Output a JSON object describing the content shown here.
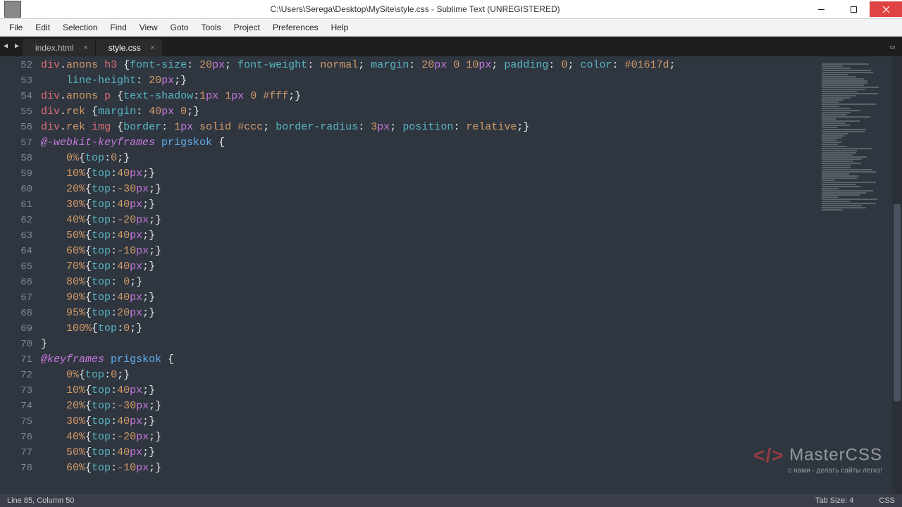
{
  "window": {
    "title": "C:\\Users\\Serega\\Desktop\\MySite\\style.css - Sublime Text (UNREGISTERED)"
  },
  "menu": {
    "items": [
      "File",
      "Edit",
      "Selection",
      "Find",
      "View",
      "Goto",
      "Tools",
      "Project",
      "Preferences",
      "Help"
    ]
  },
  "tabs": {
    "items": [
      {
        "label": "index.html",
        "active": false
      },
      {
        "label": "style.css",
        "active": true
      }
    ],
    "panes_icon": "▭"
  },
  "code": {
    "first_line_number": 52,
    "lines": [
      {
        "n": 52,
        "tokens": [
          [
            "sel",
            "div"
          ],
          [
            "punc",
            "."
          ],
          [
            "cls",
            "anons"
          ],
          [
            "punc",
            " "
          ],
          [
            "sel",
            "h3"
          ],
          [
            "punc",
            " {"
          ],
          [
            "prop",
            "font-size"
          ],
          [
            "punc",
            ": "
          ],
          [
            "num",
            "20"
          ],
          [
            "unit",
            "px"
          ],
          [
            "punc",
            "; "
          ],
          [
            "prop",
            "font-weight"
          ],
          [
            "punc",
            ": "
          ],
          [
            "val",
            "normal"
          ],
          [
            "punc",
            "; "
          ],
          [
            "prop",
            "margin"
          ],
          [
            "punc",
            ": "
          ],
          [
            "num",
            "20"
          ],
          [
            "unit",
            "px"
          ],
          [
            "punc",
            " "
          ],
          [
            "num",
            "0"
          ],
          [
            "punc",
            " "
          ],
          [
            "num",
            "10"
          ],
          [
            "unit",
            "px"
          ],
          [
            "punc",
            "; "
          ],
          [
            "prop",
            "padding"
          ],
          [
            "punc",
            ": "
          ],
          [
            "num",
            "0"
          ],
          [
            "punc",
            "; "
          ],
          [
            "prop",
            "color"
          ],
          [
            "punc",
            ": "
          ],
          [
            "hex",
            "#01617d"
          ],
          [
            "punc",
            ";"
          ]
        ]
      },
      {
        "n": 53,
        "indent": 4,
        "tokens": [
          [
            "prop",
            "line-height"
          ],
          [
            "punc",
            ": "
          ],
          [
            "num",
            "20"
          ],
          [
            "unit",
            "px"
          ],
          [
            "punc",
            ";}"
          ]
        ]
      },
      {
        "n": 54,
        "tokens": [
          [
            "sel",
            "div"
          ],
          [
            "punc",
            "."
          ],
          [
            "cls",
            "anons"
          ],
          [
            "punc",
            " "
          ],
          [
            "sel",
            "p"
          ],
          [
            "punc",
            " {"
          ],
          [
            "prop",
            "text-shadow"
          ],
          [
            "punc",
            ":"
          ],
          [
            "num",
            "1"
          ],
          [
            "unit",
            "px"
          ],
          [
            "punc",
            " "
          ],
          [
            "num",
            "1"
          ],
          [
            "unit",
            "px"
          ],
          [
            "punc",
            " "
          ],
          [
            "num",
            "0"
          ],
          [
            "punc",
            " "
          ],
          [
            "hex",
            "#fff"
          ],
          [
            "punc",
            ";}"
          ]
        ]
      },
      {
        "n": 55,
        "tokens": [
          [
            "sel",
            "div"
          ],
          [
            "punc",
            "."
          ],
          [
            "cls",
            "rek"
          ],
          [
            "punc",
            " {"
          ],
          [
            "prop",
            "margin"
          ],
          [
            "punc",
            ": "
          ],
          [
            "num",
            "40"
          ],
          [
            "unit",
            "px"
          ],
          [
            "punc",
            " "
          ],
          [
            "num",
            "0"
          ],
          [
            "punc",
            ";}"
          ]
        ]
      },
      {
        "n": 56,
        "tokens": [
          [
            "sel",
            "div"
          ],
          [
            "punc",
            "."
          ],
          [
            "cls",
            "rek"
          ],
          [
            "punc",
            " "
          ],
          [
            "sel",
            "img"
          ],
          [
            "punc",
            " {"
          ],
          [
            "prop",
            "border"
          ],
          [
            "punc",
            ": "
          ],
          [
            "num",
            "1"
          ],
          [
            "unit",
            "px"
          ],
          [
            "punc",
            " "
          ],
          [
            "val",
            "solid"
          ],
          [
            "punc",
            " "
          ],
          [
            "hex",
            "#ccc"
          ],
          [
            "punc",
            "; "
          ],
          [
            "prop",
            "border-radius"
          ],
          [
            "punc",
            ": "
          ],
          [
            "num",
            "3"
          ],
          [
            "unit",
            "px"
          ],
          [
            "punc",
            "; "
          ],
          [
            "prop",
            "position"
          ],
          [
            "punc",
            ": "
          ],
          [
            "val",
            "relative"
          ],
          [
            "punc",
            ";}"
          ]
        ]
      },
      {
        "n": 57,
        "tokens": [
          [
            "at",
            "@-webkit-keyframes"
          ],
          [
            "punc",
            " "
          ],
          [
            "id",
            "prigskok"
          ],
          [
            "punc",
            " {"
          ]
        ]
      },
      {
        "n": 58,
        "indent": 4,
        "tokens": [
          [
            "pct",
            "0%"
          ],
          [
            "punc",
            "{"
          ],
          [
            "prop",
            "top"
          ],
          [
            "punc",
            ":"
          ],
          [
            "num",
            "0"
          ],
          [
            "punc",
            ";}"
          ]
        ]
      },
      {
        "n": 59,
        "indent": 4,
        "tokens": [
          [
            "pct",
            "10%"
          ],
          [
            "punc",
            "{"
          ],
          [
            "prop",
            "top"
          ],
          [
            "punc",
            ":"
          ],
          [
            "num",
            "40"
          ],
          [
            "unit",
            "px"
          ],
          [
            "punc",
            ";}"
          ]
        ]
      },
      {
        "n": 60,
        "indent": 4,
        "tokens": [
          [
            "pct",
            "20%"
          ],
          [
            "punc",
            "{"
          ],
          [
            "prop",
            "top"
          ],
          [
            "punc",
            ":"
          ],
          [
            "num",
            "-30"
          ],
          [
            "unit",
            "px"
          ],
          [
            "punc",
            ";}"
          ]
        ]
      },
      {
        "n": 61,
        "indent": 4,
        "tokens": [
          [
            "pct",
            "30%"
          ],
          [
            "punc",
            "{"
          ],
          [
            "prop",
            "top"
          ],
          [
            "punc",
            ":"
          ],
          [
            "num",
            "40"
          ],
          [
            "unit",
            "px"
          ],
          [
            "punc",
            ";}"
          ]
        ]
      },
      {
        "n": 62,
        "indent": 4,
        "tokens": [
          [
            "pct",
            "40%"
          ],
          [
            "punc",
            "{"
          ],
          [
            "prop",
            "top"
          ],
          [
            "punc",
            ":"
          ],
          [
            "num",
            "-20"
          ],
          [
            "unit",
            "px"
          ],
          [
            "punc",
            ";}"
          ]
        ]
      },
      {
        "n": 63,
        "indent": 4,
        "tokens": [
          [
            "pct",
            "50%"
          ],
          [
            "punc",
            "{"
          ],
          [
            "prop",
            "top"
          ],
          [
            "punc",
            ":"
          ],
          [
            "num",
            "40"
          ],
          [
            "unit",
            "px"
          ],
          [
            "punc",
            ";}"
          ]
        ]
      },
      {
        "n": 64,
        "indent": 4,
        "tokens": [
          [
            "pct",
            "60%"
          ],
          [
            "punc",
            "{"
          ],
          [
            "prop",
            "top"
          ],
          [
            "punc",
            ":"
          ],
          [
            "num",
            "-10"
          ],
          [
            "unit",
            "px"
          ],
          [
            "punc",
            ";}"
          ]
        ]
      },
      {
        "n": 65,
        "indent": 4,
        "tokens": [
          [
            "pct",
            "70%"
          ],
          [
            "punc",
            "{"
          ],
          [
            "prop",
            "top"
          ],
          [
            "punc",
            ":"
          ],
          [
            "num",
            "40"
          ],
          [
            "unit",
            "px"
          ],
          [
            "punc",
            ";}"
          ]
        ]
      },
      {
        "n": 66,
        "indent": 4,
        "tokens": [
          [
            "pct",
            "80%"
          ],
          [
            "punc",
            "{"
          ],
          [
            "prop",
            "top"
          ],
          [
            "punc",
            ": "
          ],
          [
            "num",
            "0"
          ],
          [
            "punc",
            ";}"
          ]
        ]
      },
      {
        "n": 67,
        "indent": 4,
        "tokens": [
          [
            "pct",
            "90%"
          ],
          [
            "punc",
            "{"
          ],
          [
            "prop",
            "top"
          ],
          [
            "punc",
            ":"
          ],
          [
            "num",
            "40"
          ],
          [
            "unit",
            "px"
          ],
          [
            "punc",
            ";}"
          ]
        ]
      },
      {
        "n": 68,
        "indent": 4,
        "tokens": [
          [
            "pct",
            "95%"
          ],
          [
            "punc",
            "{"
          ],
          [
            "prop",
            "top"
          ],
          [
            "punc",
            ":"
          ],
          [
            "num",
            "20"
          ],
          [
            "unit",
            "px"
          ],
          [
            "punc",
            ";}"
          ]
        ]
      },
      {
        "n": 69,
        "indent": 4,
        "tokens": [
          [
            "pct",
            "100%"
          ],
          [
            "punc",
            "{"
          ],
          [
            "prop",
            "top"
          ],
          [
            "punc",
            ":"
          ],
          [
            "num",
            "0"
          ],
          [
            "punc",
            ";}"
          ]
        ]
      },
      {
        "n": 70,
        "tokens": [
          [
            "punc",
            "}"
          ]
        ]
      },
      {
        "n": 71,
        "tokens": [
          [
            "at",
            "@keyframes"
          ],
          [
            "punc",
            " "
          ],
          [
            "id",
            "prigskok"
          ],
          [
            "punc",
            " {"
          ]
        ]
      },
      {
        "n": 72,
        "indent": 4,
        "tokens": [
          [
            "pct",
            "0%"
          ],
          [
            "punc",
            "{"
          ],
          [
            "prop",
            "top"
          ],
          [
            "punc",
            ":"
          ],
          [
            "num",
            "0"
          ],
          [
            "punc",
            ";}"
          ]
        ]
      },
      {
        "n": 73,
        "indent": 4,
        "tokens": [
          [
            "pct",
            "10%"
          ],
          [
            "punc",
            "{"
          ],
          [
            "prop",
            "top"
          ],
          [
            "punc",
            ":"
          ],
          [
            "num",
            "40"
          ],
          [
            "unit",
            "px"
          ],
          [
            "punc",
            ";}"
          ]
        ]
      },
      {
        "n": 74,
        "indent": 4,
        "tokens": [
          [
            "pct",
            "20%"
          ],
          [
            "punc",
            "{"
          ],
          [
            "prop",
            "top"
          ],
          [
            "punc",
            ":"
          ],
          [
            "num",
            "-30"
          ],
          [
            "unit",
            "px"
          ],
          [
            "punc",
            ";}"
          ]
        ]
      },
      {
        "n": 75,
        "indent": 4,
        "tokens": [
          [
            "pct",
            "30%"
          ],
          [
            "punc",
            "{"
          ],
          [
            "prop",
            "top"
          ],
          [
            "punc",
            ":"
          ],
          [
            "num",
            "40"
          ],
          [
            "unit",
            "px"
          ],
          [
            "punc",
            ";}"
          ]
        ]
      },
      {
        "n": 76,
        "indent": 4,
        "tokens": [
          [
            "pct",
            "40%"
          ],
          [
            "punc",
            "{"
          ],
          [
            "prop",
            "top"
          ],
          [
            "punc",
            ":"
          ],
          [
            "num",
            "-20"
          ],
          [
            "unit",
            "px"
          ],
          [
            "punc",
            ";}"
          ]
        ]
      },
      {
        "n": 77,
        "indent": 4,
        "tokens": [
          [
            "pct",
            "50%"
          ],
          [
            "punc",
            "{"
          ],
          [
            "prop",
            "top"
          ],
          [
            "punc",
            ":"
          ],
          [
            "num",
            "40"
          ],
          [
            "unit",
            "px"
          ],
          [
            "punc",
            ";}"
          ]
        ]
      },
      {
        "n": 78,
        "indent": 4,
        "tokens": [
          [
            "pct",
            "60%"
          ],
          [
            "punc",
            "{"
          ],
          [
            "prop",
            "top"
          ],
          [
            "punc",
            ":"
          ],
          [
            "num",
            "-10"
          ],
          [
            "unit",
            "px"
          ],
          [
            "punc",
            ";}"
          ]
        ]
      }
    ]
  },
  "status": {
    "left": "Line 85, Column 50",
    "tab_size": "Tab Size: 4",
    "syntax": "CSS"
  },
  "watermark": {
    "line1a": "Master",
    "line1b": "CSS",
    "line2": "с нами - делать сайты легко!"
  }
}
